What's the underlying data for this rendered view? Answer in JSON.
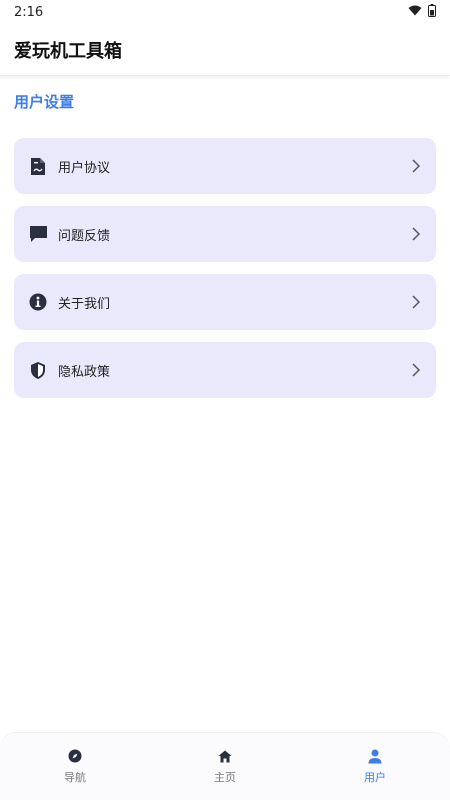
{
  "status_bar": {
    "time": "2:16",
    "icons": [
      "wifi-icon",
      "battery-icon"
    ]
  },
  "app_bar": {
    "title": "爱玩机工具箱"
  },
  "section": {
    "title": "用户设置"
  },
  "menu": {
    "items": [
      {
        "label": "用户协议",
        "icon": "document-icon"
      },
      {
        "label": "问题反馈",
        "icon": "chat-bubble-icon"
      },
      {
        "label": "关于我们",
        "icon": "info-icon"
      },
      {
        "label": "隐私政策",
        "icon": "shield-icon"
      }
    ]
  },
  "bottom_nav": {
    "items": [
      {
        "label": "导航",
        "icon": "compass-icon",
        "active": false
      },
      {
        "label": "主页",
        "icon": "home-icon",
        "active": false
      },
      {
        "label": "用户",
        "icon": "user-icon",
        "active": true
      }
    ]
  },
  "colors": {
    "accent": "#3f7de8",
    "card_background": "#e9e9fb",
    "icon_dark": "#2b3040"
  }
}
